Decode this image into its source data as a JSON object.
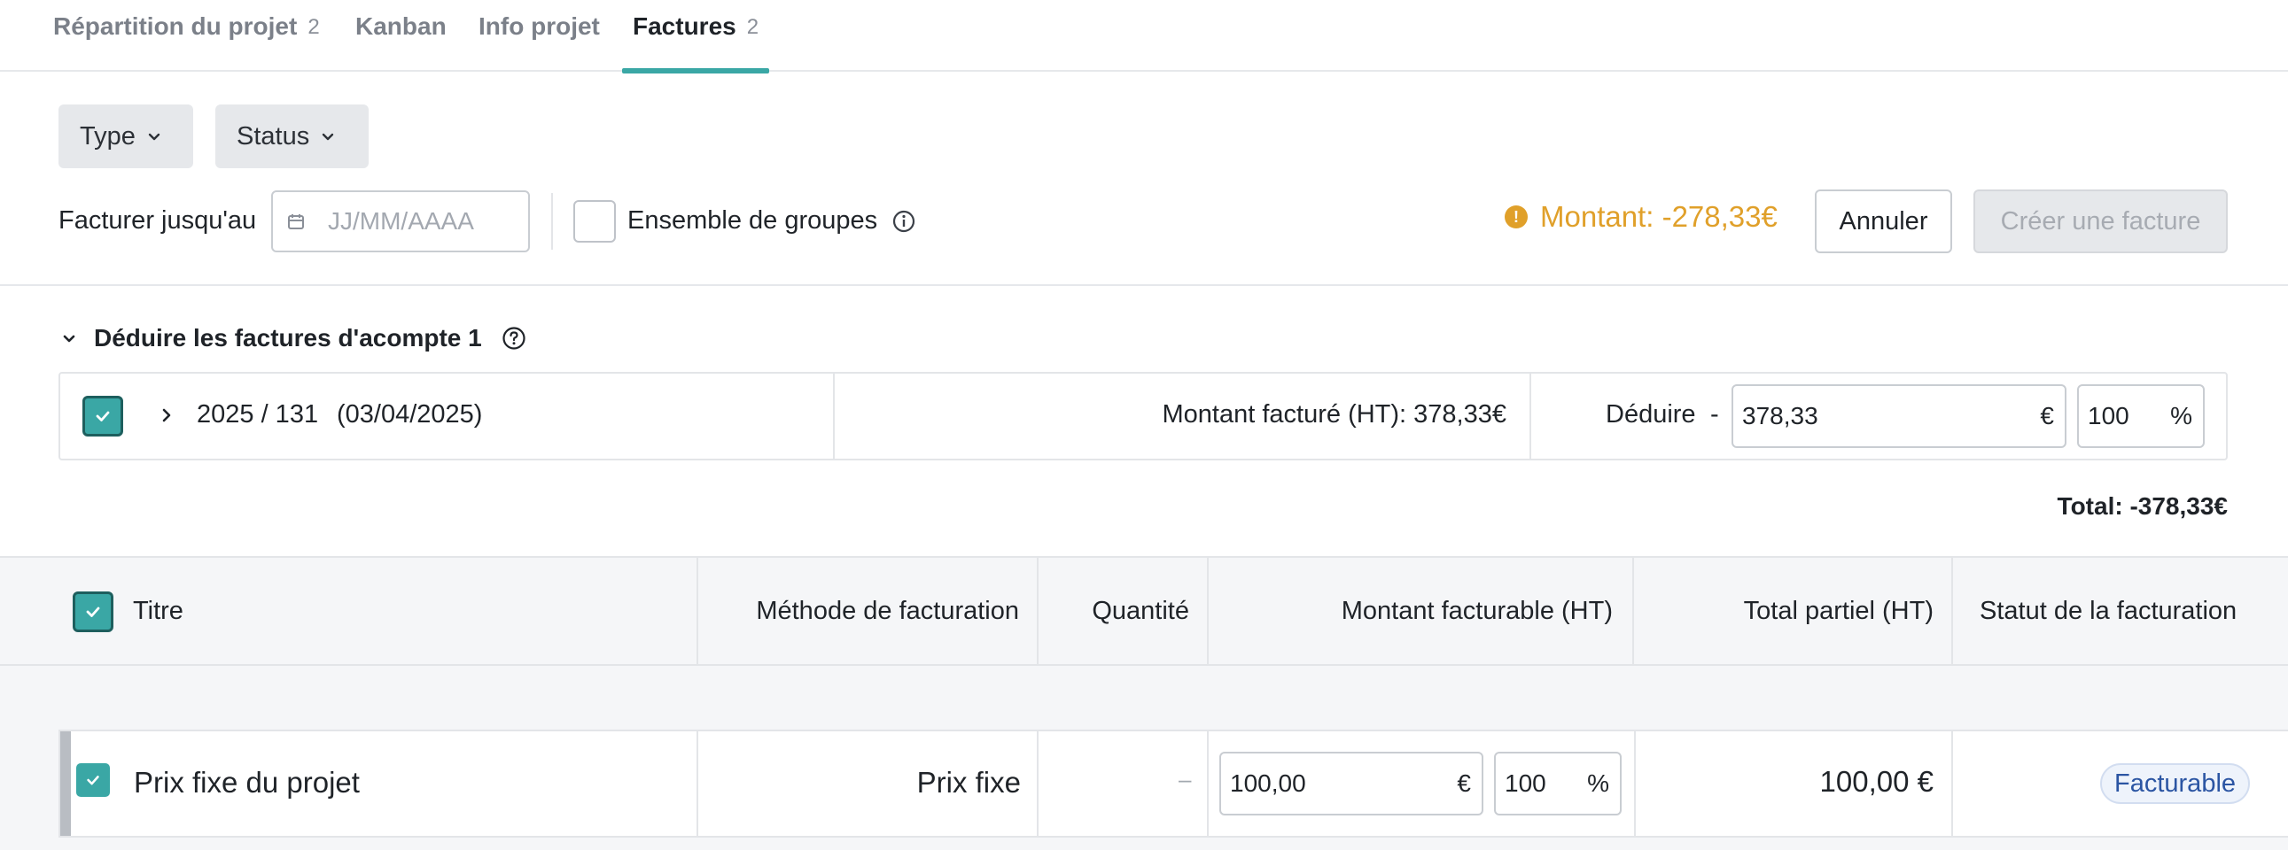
{
  "tabs": [
    {
      "label": "Répartition du projet",
      "count": "2"
    },
    {
      "label": "Kanban",
      "count": ""
    },
    {
      "label": "Info projet",
      "count": ""
    },
    {
      "label": "Factures",
      "count": "2"
    }
  ],
  "filters": {
    "type_label": "Type",
    "status_label": "Status"
  },
  "toolbar": {
    "invoice_until_label": "Facturer jusqu'au",
    "date_placeholder": "JJ/MM/AAAA",
    "group_set_label": "Ensemble de groupes",
    "amount_warning": "Montant: -278,33€",
    "cancel_label": "Annuler",
    "create_label": "Créer une facture"
  },
  "acompte": {
    "title": "Déduire les factures d'acompte 1",
    "invoice_number": "2025 / 131",
    "invoice_date": "(03/04/2025)",
    "billed_amount": "Montant facturé (HT): 378,33€",
    "deduct_label": "Déduire",
    "deduct_sign": "-",
    "deduct_value": "378,33",
    "currency": "€",
    "percent_value": "100",
    "percent_sign": "%",
    "total": "Total: -378,33€"
  },
  "table": {
    "columns": [
      "Titre",
      "Méthode de facturation",
      "Quantité",
      "Montant facturable (HT)",
      "Total partiel (HT)",
      "Statut de la facturation"
    ],
    "rows": [
      {
        "title": "Prix fixe du projet",
        "method": "Prix fixe",
        "quantity": "–",
        "amount": "100,00",
        "currency": "€",
        "percent": "100",
        "percent_sign": "%",
        "subtotal": "100,00 €",
        "status": "Facturable"
      }
    ]
  },
  "colors": {
    "accent": "#3aa7a5",
    "warning": "#e0a02a",
    "status_badge": "#2b55a3"
  }
}
